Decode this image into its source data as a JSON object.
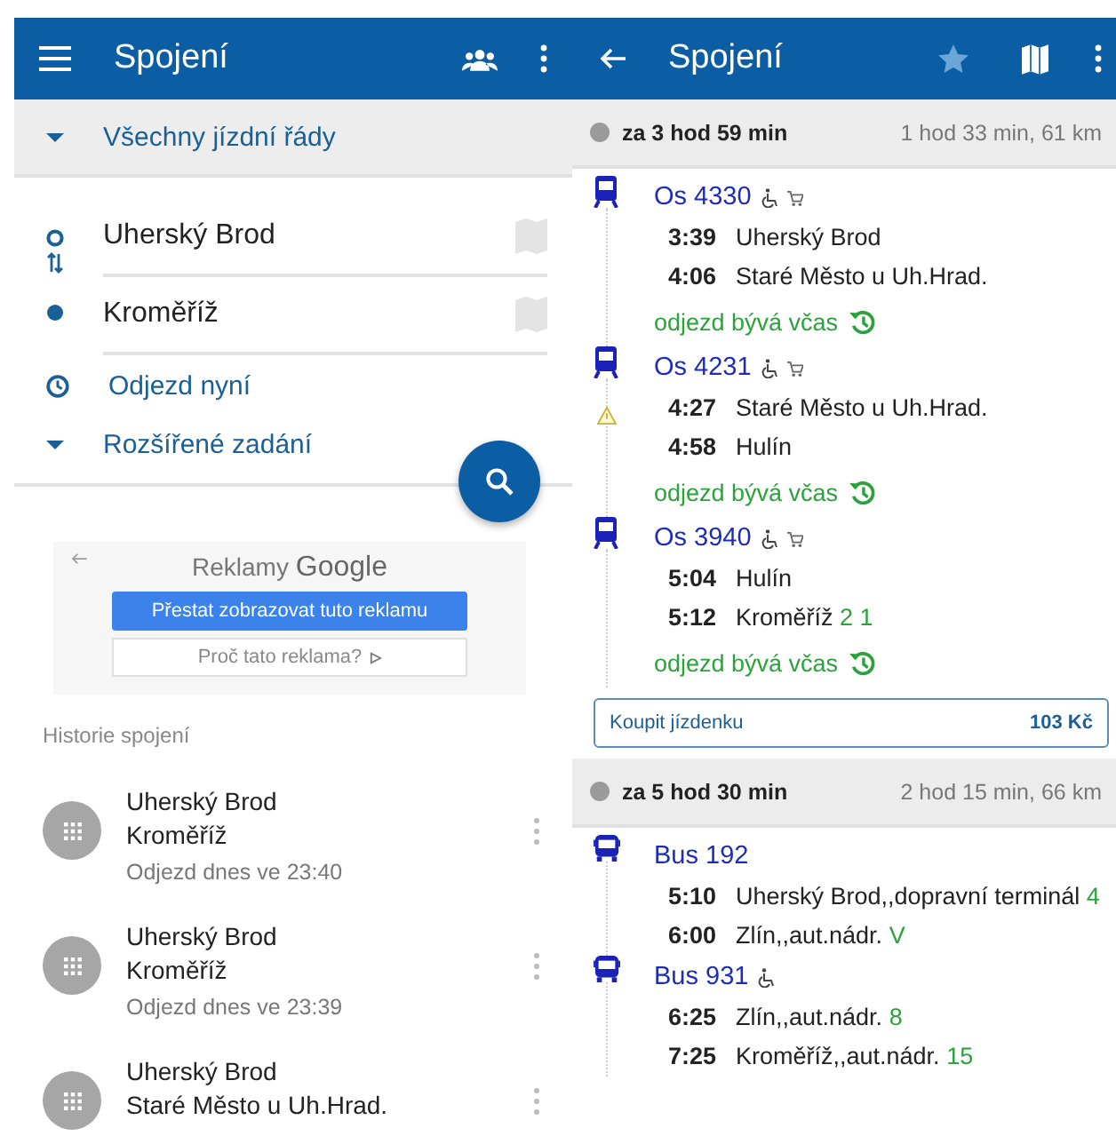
{
  "left": {
    "title": "Spojení",
    "filter": "Všechny jízdní řády",
    "from": "Uherský Brod",
    "to": "Kroměříž",
    "time": "Odjezd nyní",
    "advanced": "Rozšířené zadání",
    "ad": {
      "title": "Reklamy",
      "brand": "Google",
      "stop": "Přestat zobrazovat tuto reklamu",
      "why": "Proč tato reklama?"
    },
    "history_title": "Historie spojení",
    "history": [
      {
        "from": "Uherský Brod",
        "to": "Kroměříž",
        "when": "Odjezd dnes ve 23:40"
      },
      {
        "from": "Uherský Brod",
        "to": "Kroměříž",
        "when": "Odjezd dnes ve 23:39"
      },
      {
        "from": "Uherský Brod",
        "to": "Staré Město u Uh.Hrad."
      }
    ]
  },
  "right": {
    "title": "Spojení",
    "connections": [
      {
        "departs_in": "za 3 hod 59 min",
        "summary": "1 hod 33 min, 61 km",
        "price": "103 Kč",
        "buy": "Koupit jízdenku",
        "legs": [
          {
            "kind": "train",
            "name": "Os 4330",
            "accessible": true,
            "cart": true,
            "warning": false,
            "stops": [
              {
                "time": "3:39",
                "place": "Uherský Brod"
              },
              {
                "time": "4:06",
                "place": "Staré Město u Uh.Hrad."
              }
            ],
            "note": "odjezd bývá včas"
          },
          {
            "kind": "train",
            "name": "Os 4231",
            "accessible": true,
            "cart": true,
            "warning": true,
            "stops": [
              {
                "time": "4:27",
                "place": "Staré Město u Uh.Hrad."
              },
              {
                "time": "4:58",
                "place": "Hulín"
              }
            ],
            "note": "odjezd bývá včas"
          },
          {
            "kind": "train",
            "name": "Os 3940",
            "accessible": true,
            "cart": true,
            "warning": false,
            "stops": [
              {
                "time": "5:04",
                "place": "Hulín"
              },
              {
                "time": "5:12",
                "place": "Kroměříž",
                "platform": "2 1"
              }
            ],
            "note": "odjezd bývá včas"
          }
        ]
      },
      {
        "departs_in": "za 5 hod 30 min",
        "summary": "2 hod 15 min, 66 km",
        "legs": [
          {
            "kind": "bus",
            "name": "Bus 192",
            "accessible": false,
            "cart": false,
            "warning": false,
            "stops": [
              {
                "time": "5:10",
                "place": "Uherský Brod,,dopravní terminál",
                "platform": "4"
              },
              {
                "time": "6:00",
                "place": "Zlín,,aut.nádr.",
                "platform": "V"
              }
            ]
          },
          {
            "kind": "bus",
            "name": "Bus 931",
            "accessible": true,
            "cart": false,
            "warning": false,
            "stops": [
              {
                "time": "6:25",
                "place": "Zlín,,aut.nádr.",
                "platform": "8"
              },
              {
                "time": "7:25",
                "place": "Kroměříž,,aut.nádr.",
                "platform": "15"
              }
            ]
          }
        ]
      }
    ]
  }
}
